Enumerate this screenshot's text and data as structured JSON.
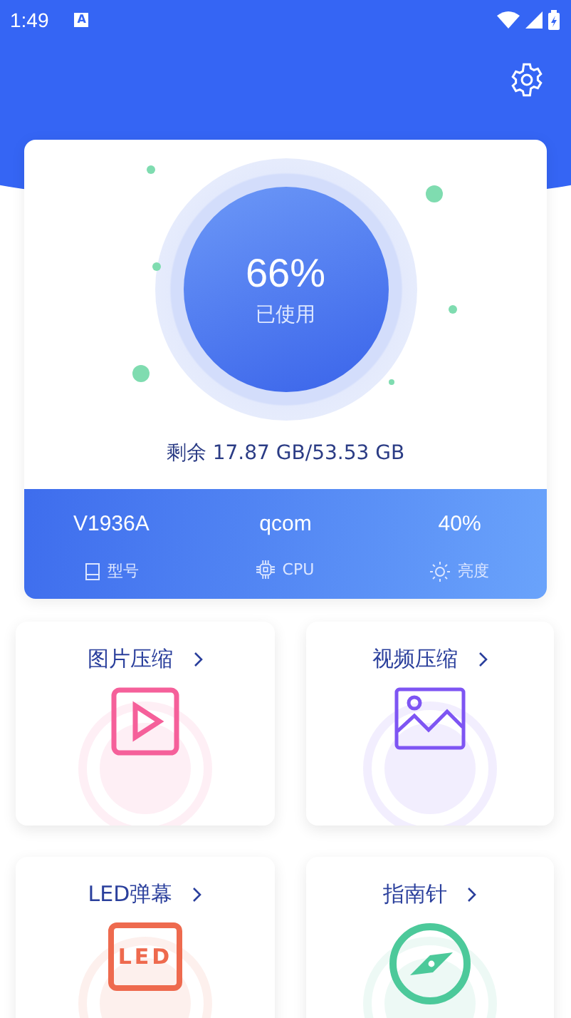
{
  "status_bar": {
    "time": "1:49",
    "notification": "A"
  },
  "storage": {
    "percent": "66%",
    "label": "已使用",
    "remaining": "剩余 17.87 GB/53.53 GB"
  },
  "stats": [
    {
      "kind": "model",
      "value": "V1936A",
      "label": "型号"
    },
    {
      "kind": "cpu",
      "value": "qcom",
      "label": "CPU"
    },
    {
      "kind": "brightness",
      "value": "40%",
      "label": "亮度"
    }
  ],
  "features": [
    {
      "kind": "video",
      "title": "图片压缩",
      "color": "#f5609a"
    },
    {
      "kind": "image",
      "title": "视频压缩",
      "color": "#7e55f3"
    },
    {
      "kind": "led",
      "title": "LED弹幕",
      "icon_text": "LED",
      "color": "#ee6a4e"
    },
    {
      "kind": "compass",
      "title": "指南针",
      "color": "#4cc99a"
    }
  ]
}
